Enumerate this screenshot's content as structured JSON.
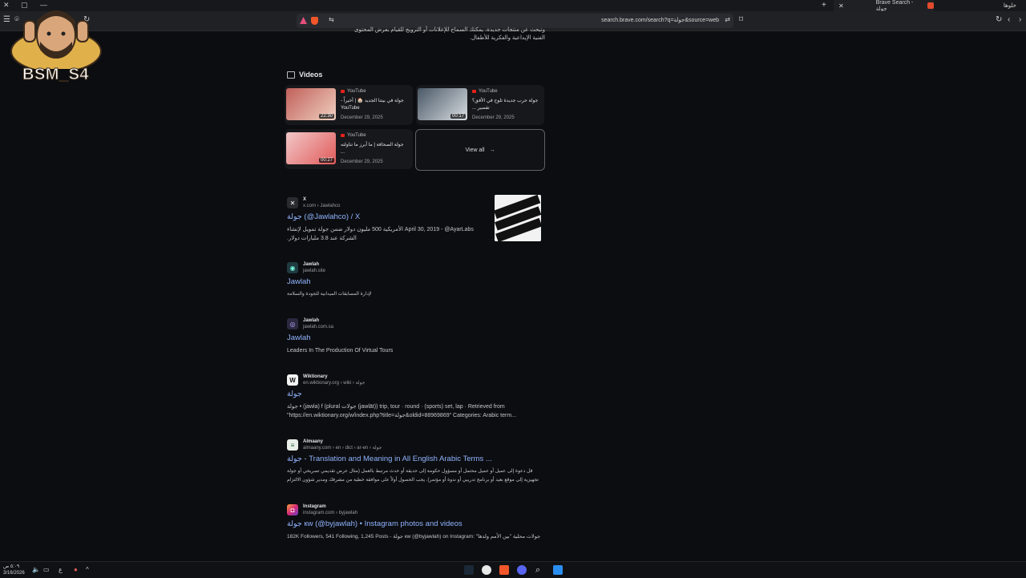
{
  "browser": {
    "tab_title": "Brave Search - جولة",
    "window_label": "خلوها",
    "url": "search.brave.com/search?q=جولة&source=web"
  },
  "overlay": {
    "name": "BSM_S4"
  },
  "top_snippet": {
    "line1": "وتبحث عن منتجات جديدة، يمكنك السماح للإعلانات أو الترويج للقيام بعرض المحتوى",
    "line2": "الفنية الإبداعية والفكرية للأطفال."
  },
  "videos": {
    "heading": "Videos",
    "items": [
      {
        "source": "YouTube",
        "title": "جولة في بيتنا الجديد 🏠 | أخيراً - YouTube",
        "date": "December 29, 2025",
        "duration": "22:30",
        "color": "#c0605a"
      },
      {
        "source": "YouTube",
        "title": "جولة حرب جديدة تلوح في الأفق؟ تقصير ...",
        "date": "December 29, 2025",
        "duration": "00:17",
        "color": "#6a7a8a"
      },
      {
        "source": "YouTube",
        "title": "جولة الصحافة | ما أبرز ما تناولته ...",
        "date": "December 29, 2025",
        "duration": "00:27",
        "color": "#d98c8c"
      }
    ],
    "view_all": "View all"
  },
  "results": [
    {
      "site": "X",
      "path": "x.com › Jawlahco",
      "title": "جولة (@Jawlahco) / X",
      "desc": "April 30, 2019 - @AyarLabs الأمريكية 500 مليون دولار ضمن جولة تمويل لإنشاء الشركة عند 3.8 مليارات دولار.",
      "icon": "X"
    },
    {
      "site": "Jawlah",
      "path": "jawlah.site",
      "title": "Jawlah",
      "desc": "لإدارة المسابقات الميدانية للجودة والسلامة",
      "icon": "J"
    },
    {
      "site": "Jawlah",
      "path": "jawlah.com.sa",
      "title": "Jawlah",
      "desc": "Leaders In The Production Of Virtual Tours",
      "icon": "J"
    },
    {
      "site": "Wiktionary",
      "path": "en.wiktionary.org › wiki › جولة",
      "title": "جولة",
      "desc": "جولة • (jawla) f (plural جولات (jawlāt)) trip, tour · round · (sports) set, lap · Retrieved from \"https://en.wiktionary.org/w/index.php?title=جولة&oldid=88969869\" Categories: Arabic term...",
      "icon": "W"
    },
    {
      "site": "Almaany",
      "path": "almaany.com › en › dict › ar-en › جولة",
      "title": "جولة - Translation and Meaning in All English Arabic Terms ...",
      "desc": "قل دعوة إلى عميل أو عميل محتمل أو مسؤول حكومة إلى حديقة أو حدث مرتبط بالعمل (مثال عرض تقديمي تصريحي أو جولة تجهيزية إلى موقع بعيد أو برنامج تدريبي أو ندوة أو مؤتمر). يجب الحصول أولاً على موافقة خطية من مشرفك ومدير شؤون الالتزام",
      "icon": "A"
    },
    {
      "site": "Instagram",
      "path": "instagram.com › byjawlah",
      "title": "جولة кw (@byjawlah) • Instagram photos and videos",
      "desc": "182K Followers, 541 Following, 1,245 Posts - جولة кw (@byjawlah) on Instagram: \"جولات محلية \"بين الأمم ولدها",
      "icon": "I"
    }
  ],
  "taskbar": {
    "time": "٥:٠٩ ص",
    "date": "3/16/2026",
    "lang": "ع"
  }
}
